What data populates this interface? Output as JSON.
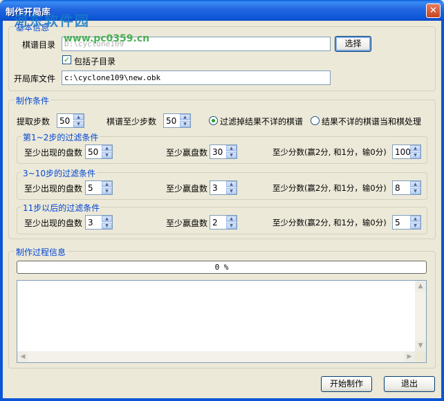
{
  "window": {
    "title": "制作开局库",
    "close_label": "✕"
  },
  "watermark": {
    "line1": "河东软件园",
    "line2": "www.pc0359.cn"
  },
  "basic": {
    "legend": "基本信息",
    "dir_label": "棋谱目录",
    "dir_value": "D:\\cyclone109",
    "select_label": "选择",
    "include_sub_label": "包括子目录",
    "include_sub_checked": true,
    "file_label": "开局库文件",
    "file_value": "c:\\cyclone109\\new.obk"
  },
  "conditions": {
    "legend": "制作条件",
    "extract_steps_label": "提取步数",
    "extract_steps_value": "50",
    "min_steps_label": "棋谱至少步数",
    "min_steps_value": "50",
    "radio1_label": "过滤掉结果不详的棋谱",
    "radio1_selected": true,
    "radio2_label": "结果不详的棋谱当和棋处理",
    "radio2_selected": false,
    "groups": [
      {
        "legend": "第1~2步的过滤条件",
        "appear_label": "至少出现的盘数",
        "appear_value": "50",
        "win_label": "至少赢盘数",
        "win_value": "30",
        "score_label": "至少分数(赢2分, 和1分，输0分)",
        "score_value": "100"
      },
      {
        "legend": "3~10步的过滤条件",
        "appear_label": "至少出现的盘数",
        "appear_value": "5",
        "win_label": "至少赢盘数",
        "win_value": "3",
        "score_label": "至少分数(赢2分, 和1分，输0分)",
        "score_value": "8"
      },
      {
        "legend": "11步以后的过滤条件",
        "appear_label": "至少出现的盘数",
        "appear_value": "3",
        "win_label": "至少赢盘数",
        "win_value": "2",
        "score_label": "至少分数(赢2分, 和1分，输0分)",
        "score_value": "5"
      }
    ]
  },
  "process": {
    "legend": "制作过程信息",
    "progress_text": "0 %",
    "progress_value": 0,
    "log_text": ""
  },
  "footer": {
    "start_label": "开始制作",
    "exit_label": "退出"
  },
  "colors": {
    "titlebar": "#0b55d6",
    "legend": "#0046d5",
    "background": "#ece9d8"
  }
}
